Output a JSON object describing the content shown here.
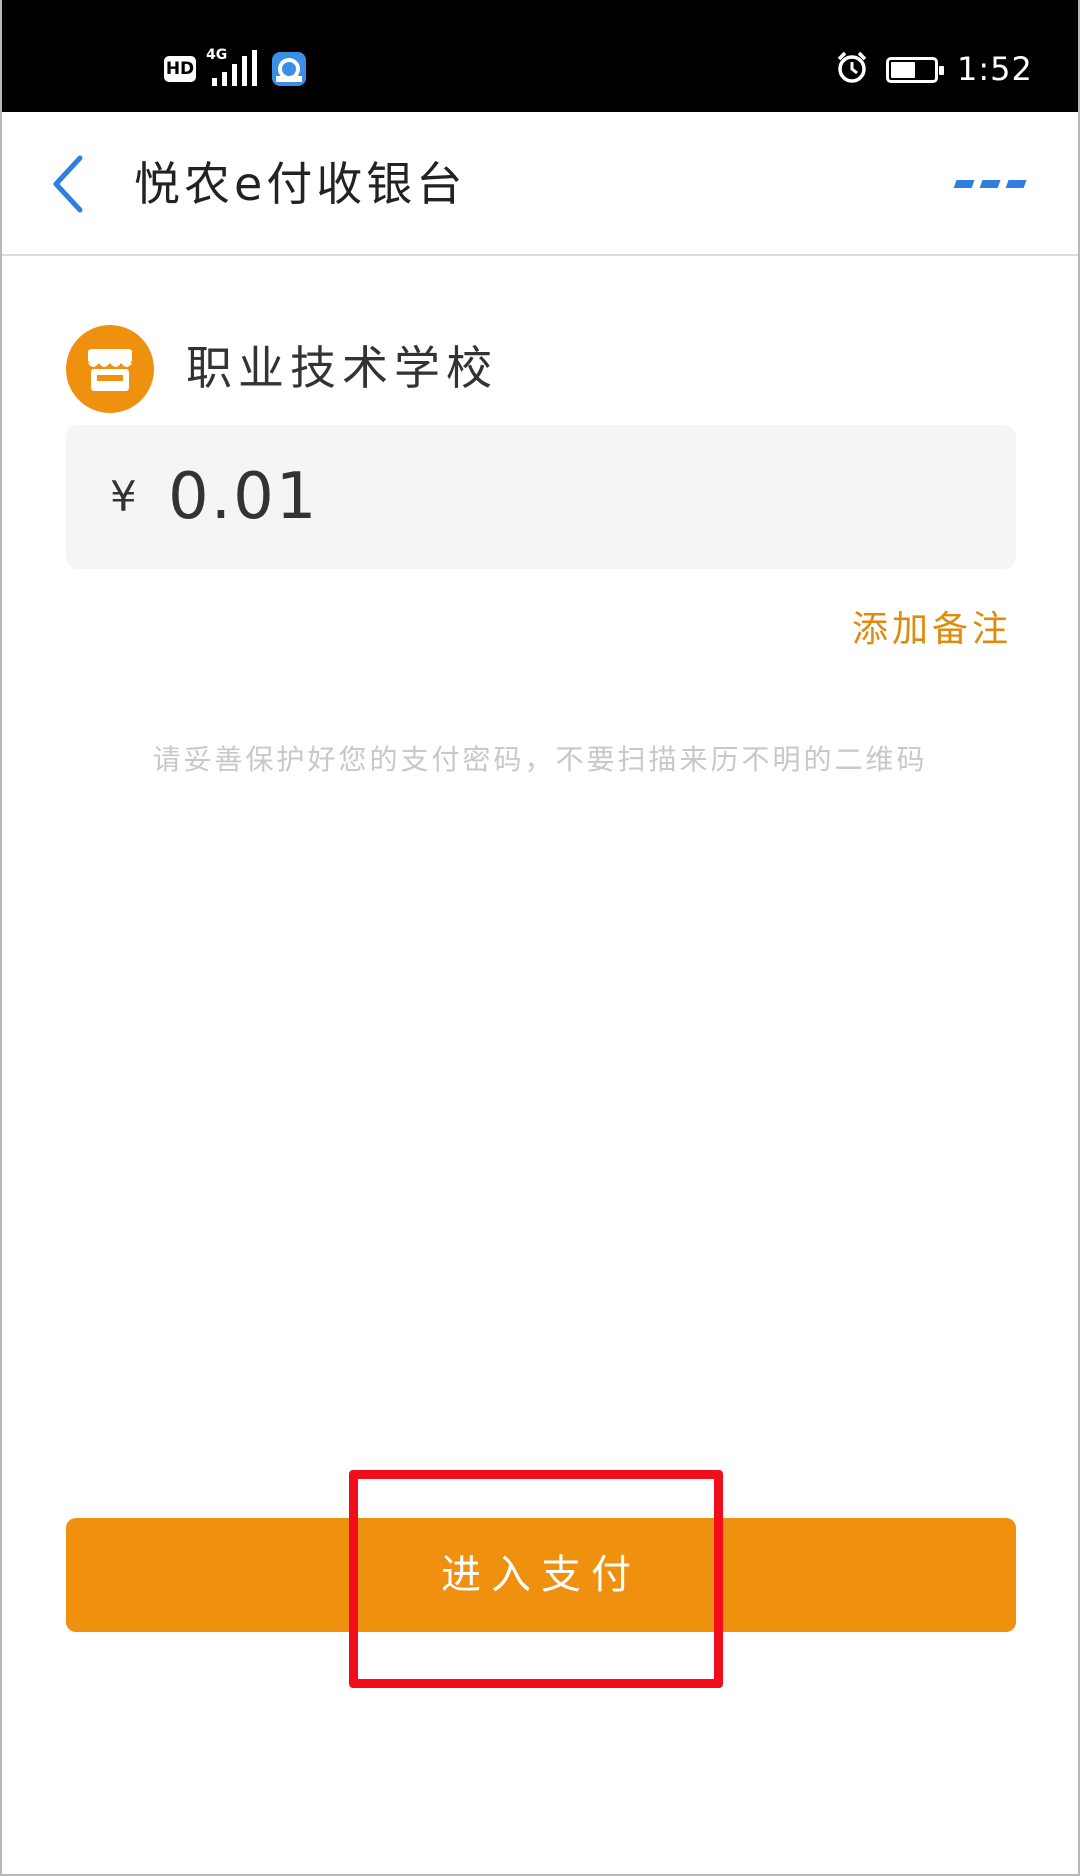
{
  "status_bar": {
    "hd_badge": "HD",
    "network": "4G",
    "time": "1:52"
  },
  "header": {
    "title": "悦农e付收银台"
  },
  "merchant": {
    "name": "职业技术学校"
  },
  "amount": {
    "currency_symbol": "¥",
    "value": "0.01"
  },
  "add_note_label": "添加备注",
  "hint_text": "请妥善保护好您的支付密码，不要扫描来历不明的二维码",
  "pay_button_label": "进入支付",
  "colors": {
    "accent": "#f0900f",
    "link_blue": "#2f7fe0",
    "highlight_red": "#f20d1a"
  }
}
